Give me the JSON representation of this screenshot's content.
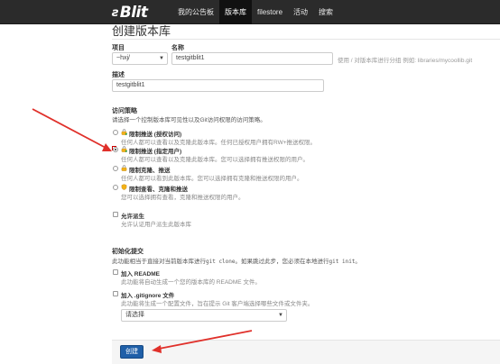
{
  "nav": {
    "logo_mark": "ƨ",
    "logo_text": "Blit",
    "items": [
      {
        "label": "我的公告板",
        "active": false
      },
      {
        "label": "版本库",
        "active": true
      },
      {
        "label": "filestore",
        "active": false
      },
      {
        "label": "活动",
        "active": false
      },
      {
        "label": "搜索",
        "active": false
      }
    ]
  },
  "page": {
    "title": "创建版本库",
    "project_label": "项目",
    "project_value": "~hxj/",
    "name_label": "名称",
    "name_value": "testgitblit1",
    "name_hint": "使用 / 对版本库进行分组 例如:  libraries/mycoollib.git",
    "description_label": "描述",
    "description_value": "testgitblit1",
    "access": {
      "title": "访问策略",
      "desc": "请选择一个控制版本库可见性以及Git访问权限的访问策略。",
      "options": [
        {
          "title": "限制推送 (授权访问)",
          "sub": "任何人都可以查看以及克隆此版本库。任何已授权用户拥有RW+推送权限。",
          "checked": false
        },
        {
          "title": "限制推送 (指定用户)",
          "sub": "任何人都可以查看以及克隆此版本库。您可以选择拥有推送权限的用户。",
          "checked": true
        },
        {
          "title": "限制克隆、推送",
          "sub": "任何人都可以看到此版本库。您可以选择拥有克隆和推送权限的用户。",
          "checked": false
        },
        {
          "title": "限制查看、克隆和推送",
          "sub": "您可以选择拥有查看，克隆和推送权限的用户。",
          "checked": false
        }
      ]
    },
    "allow_fork": {
      "title": "允许派生",
      "sub": "允许认证用户派生此版本库"
    },
    "init": {
      "title": "初始化提交",
      "desc_1": "此功能相当于直接对当前版本库进行",
      "code_1": "git clone",
      "desc_2": "。如果跳过此步，您必须在本地进行",
      "code_2": "git init",
      "desc_3": "。",
      "readme_title": "加入 README",
      "readme_sub": "此功能将自动生成一个您的版本库的 README 文件。",
      "gitignore_title": "加入 .gitignore 文件",
      "gitignore_sub": "此功能将生成一个配置文件，旨在提示 Git 客户端选择哪些文件或文件夹。",
      "gitignore_select": "请选择"
    },
    "create_button": "创建"
  },
  "colors": {
    "navbar": "#2b2b2b",
    "button": "#1f5fa8",
    "arrow": "#e0302a"
  }
}
